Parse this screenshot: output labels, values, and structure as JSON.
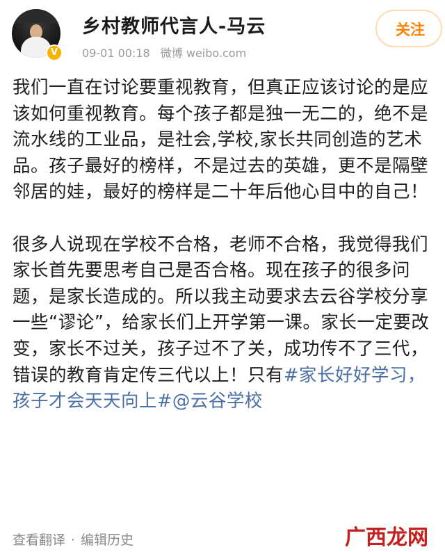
{
  "header": {
    "author_name": "乡村教师代言人-马云",
    "timestamp": "09-01 00:18",
    "source": "微博 weibo.com",
    "follow_label": "关注",
    "verified_glyph": "V"
  },
  "post": {
    "paragraph_1": "我们一直在讨论要重视教育，但真正应该讨论的是应该如何重视教育。每个孩子都是独一无二的，绝不是流水线的工业品，是社会,学校,家长共同创造的艺术品。孩子最好的榜样，不是过去的英雄，更不是隔壁邻居的娃，最好的榜样是二十年后他心目中的自己！",
    "paragraph_2_text": "很多人说现在学校不合格，老师不合格，我觉得我们家长首先要思考自己是否合格。现在孩子的很多问题，是家长造成的。所以我主动要求去云谷学校分享一些“谬论”，给家长们上开学第一课。家长一定要改变，家长不过关，孩子过不了关，成功传不了三代，错误的教育肯定传三代以上！只有",
    "hashtag": "#家长好好学习，孩子才会天天向上#",
    "mention": "@云谷学校"
  },
  "footer": {
    "view_translation": "查看翻译",
    "separator": "·",
    "edit_history": "编辑历史"
  },
  "watermark": "广西龙网",
  "colors": {
    "link": "#4a6fa5",
    "follow": "#ff8200",
    "badge": "#f6b400",
    "watermark": "#c62020"
  }
}
